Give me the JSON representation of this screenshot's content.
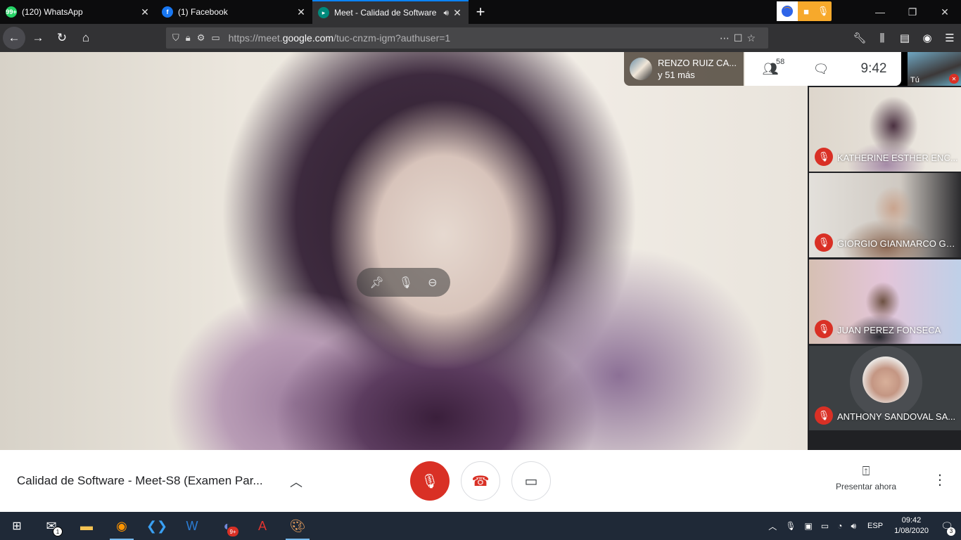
{
  "browser": {
    "tabs": [
      {
        "title": "(120) WhatsApp",
        "fav_text": "99+",
        "fav_color": "#25d366"
      },
      {
        "title": "(1) Facebook",
        "fav_text": "f",
        "fav_color": "#1877f2"
      },
      {
        "title": "Meet - Calidad de Software",
        "fav_text": "",
        "fav_color": "#00897b"
      }
    ],
    "new_tab": "+",
    "url_prefix": "https://meet.",
    "url_domain": "google.com",
    "url_path": "/tuc-cnzm-igm?authuser=1"
  },
  "meeting": {
    "presenter_name": "RENZO RUIZ CA...",
    "presenter_more": "y 51 más",
    "participant_count": "58",
    "time": "9:42",
    "self_label": "Tú",
    "title": "Calidad de Software - Meet-S8 (Examen Par...",
    "present_label": "Presentar ahora"
  },
  "participants": [
    {
      "name": "KATHERINE ESTHER ENC..."
    },
    {
      "name": "GIORGIO GIANMARCO GA..."
    },
    {
      "name": "JUAN PEREZ FONSECA"
    },
    {
      "name": "ANTHONY SANDOVAL SA..."
    }
  ],
  "taskbar": {
    "mail_badge": "1",
    "discord_badge": "9+",
    "lang": "ESP",
    "clock_time": "09:42",
    "clock_date": "1/08/2020",
    "notif_count": "3"
  },
  "colors": {
    "accent_red": "#d93025",
    "tab_active_border": "#0a84ff"
  }
}
